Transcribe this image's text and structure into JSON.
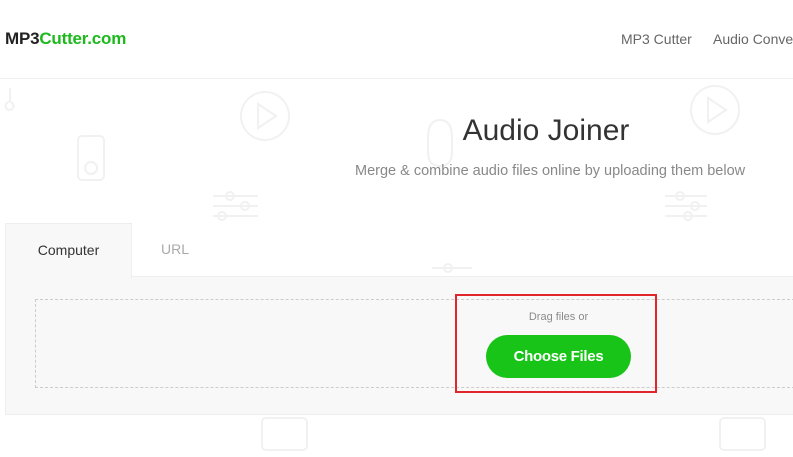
{
  "header": {
    "logo_prefix": "MP3",
    "logo_suffix": "Cutter.com",
    "nav": [
      "MP3 Cutter",
      "Audio Conve"
    ]
  },
  "main": {
    "title": "Audio Joiner",
    "subtitle": "Merge & combine audio files online by uploading them below"
  },
  "tabs": [
    {
      "label": "Computer",
      "active": true
    },
    {
      "label": "URL",
      "active": false
    }
  ],
  "upload": {
    "drag_text": "Drag files or",
    "button_label": "Choose Files"
  },
  "colors": {
    "brand_green": "#17c417",
    "logo_green": "#1db91d",
    "highlight": "#e0262b"
  }
}
